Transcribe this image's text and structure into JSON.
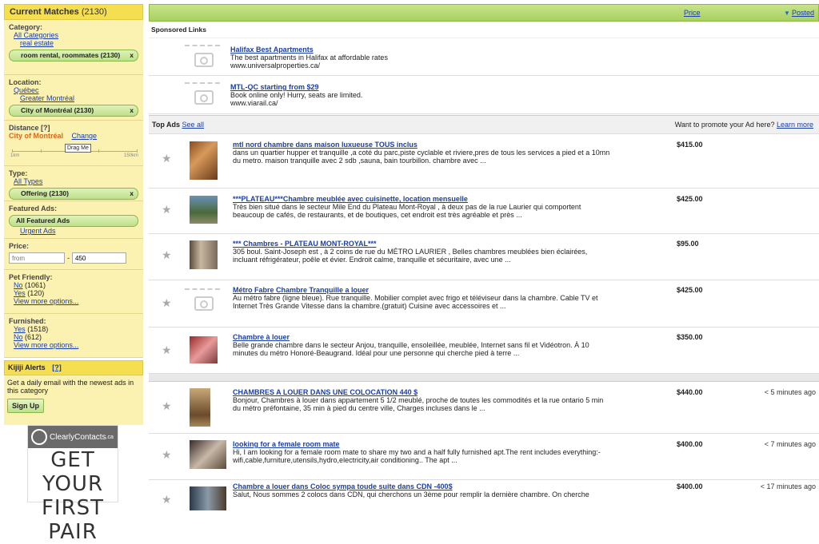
{
  "sidebar": {
    "header_label": "Current Matches",
    "header_count": "(2130)",
    "category": {
      "title": "Category:",
      "all": "All Categories",
      "sub": "real estate",
      "pill": "room rental, roommates  (2130)"
    },
    "location": {
      "title": "Location:",
      "l1": "Québec",
      "l2": "Greater Montréal",
      "pill": "City of Montréal  (2130)"
    },
    "distance": {
      "title": "Distance [?]",
      "city": "City of Montréal",
      "change": "Change",
      "handle": "Drag Me",
      "min": "1km",
      "max": "150km"
    },
    "type": {
      "title": "Type:",
      "all": "All Types",
      "pill": "Offering  (2130)"
    },
    "featured": {
      "title": "Featured Ads:",
      "pill": "All Featured Ads",
      "urgent": "Urgent Ads"
    },
    "price": {
      "title": "Price:",
      "from_placeholder": "from",
      "to_value": "450",
      "dash": "-"
    },
    "pet": {
      "title": "Pet Friendly:",
      "no": "No",
      "no_cnt": "(1061)",
      "yes": "Yes",
      "yes_cnt": "(120)",
      "more": "View more options..."
    },
    "furnished": {
      "title": "Furnished:",
      "yes": "Yes",
      "yes_cnt": "(1518)",
      "no": "No",
      "no_cnt": "(612)",
      "more": "View more options..."
    },
    "alerts": {
      "title": "Kijiji Alerts",
      "help": "[?]",
      "text": "Get a daily email with the newest ads in this category",
      "signup": "Sign Up"
    },
    "banner": {
      "brand": "ClearlyContacts",
      "brand_suffix": ".ca",
      "line1": "GET YOUR",
      "line2": "FIRST PAIR"
    }
  },
  "main": {
    "header": {
      "price": "Price",
      "posted": "Posted"
    },
    "sponsored_label": "Sponsored Links",
    "sponsored": [
      {
        "title": "Halifax Best Apartments",
        "desc": "The best apartments in Halifax at affordable rates",
        "url": "www.universalproperties.ca/"
      },
      {
        "title": "MTL-QC starting from $29",
        "desc": "Book online only! Hurry, seats are limited.",
        "url": "www.viarail.ca/"
      }
    ],
    "topads": {
      "label": "Top Ads",
      "see_all": "See all",
      "promote": "Want to promote your Ad here?",
      "learn": "Learn more"
    },
    "ads": [
      {
        "title": "mtl nord chambre dans maison luxueuse TOUS inclus",
        "l1": "dans un quartier hupper et tranquille ,a coté du parc,piste cyclable et riviere,pres de tous les services a pied et a 10mn",
        "l2": "du metro. maison tranquille avec 2 sdb ,sauna, bain tourbillon. chambre avec ...",
        "price": "$415.00",
        "time": ""
      },
      {
        "title": "***PLATEAU***Chambre meublée avec cuisinette, location mensuelle",
        "l1": "Très bien situé dans le secteur Mile End du Plateau Mont-Royal , à deux pas de la rue Laurier qui comportent",
        "l2": "beaucoup de cafés, de restaurants, et de boutiques, cet endroit est très agréable et près ...",
        "price": "$425.00",
        "time": ""
      },
      {
        "title": "*** Chambres - PLATEAU MONT-ROYAL***",
        "l1": "305 boul. Saint-Joseph est , à 2 coins de rue du MÉTRO LAURIER , Belles chambres meublées bien éclairées,",
        "l2": "incluant réfrigérateur, poêle et évier. Endroit calme, tranquille et sécuritaire, avec une ...",
        "price": "$95.00",
        "time": ""
      },
      {
        "title": "Métro Fabre Chambre Tranquille a louer",
        "l1": "Au métro fabre (ligne bleue). Rue tranquille. Mobilier complet avec frigo et téléviseur dans la chambre. Cable TV et",
        "l2": "Internet Très Grande Vitesse dans la chambre.(gratuit) Cuisine avec accessoires et ...",
        "price": "$425.00",
        "time": ""
      },
      {
        "title": "Chambre à louer",
        "l1": "Belle grande chambre dans le secteur Anjou, tranquille, ensoleillée, meublée, Internet sans fil et Vidéotron. À 10",
        "l2": "minutes du métro Honoré-Beaugrand. Idéal pour une personne qui cherche pied à terre ...",
        "price": "$350.00",
        "time": ""
      },
      {
        "title": "CHAMBRES A LOUER DANS UNE COLOCATION 440 $",
        "l1": "Bonjour, Chambres à louer dans appartement 5 1/2 meublé, proche de toutes les commodités et la rue ontario 5 min",
        "l2": "du métro préfontaine, 35 min à pied du centre ville, Charges incluses dans le ...",
        "price": "$440.00",
        "time": "< 5 minutes ago"
      },
      {
        "title": "looking for a female room mate",
        "l1": "Hi, I am looking for a female room mate to share my two and a half fully furnished apt.The rent includes everything:-",
        "l2": "wifi,cable,furniture,utensils,hydro,electricity,air conditioning.. The apt ...",
        "price": "$400.00",
        "time": "< 7 minutes ago"
      },
      {
        "title": "Chambre a louer dans Coloc sympa toude suite dans CDN -400$",
        "l1": "Salut, Nous sommes 2 colocs dans CDN, qui cherchons un 3ème pour remplir la dernière chambre. On cherche",
        "l2": "",
        "price": "$400.00",
        "time": "< 17 minutes ago"
      }
    ]
  },
  "colors": {
    "yellow": "#f5de50",
    "panel": "#fbf2b2",
    "green": "#a8d060",
    "link": "#1a3ea8",
    "orange": "#e0661a"
  }
}
